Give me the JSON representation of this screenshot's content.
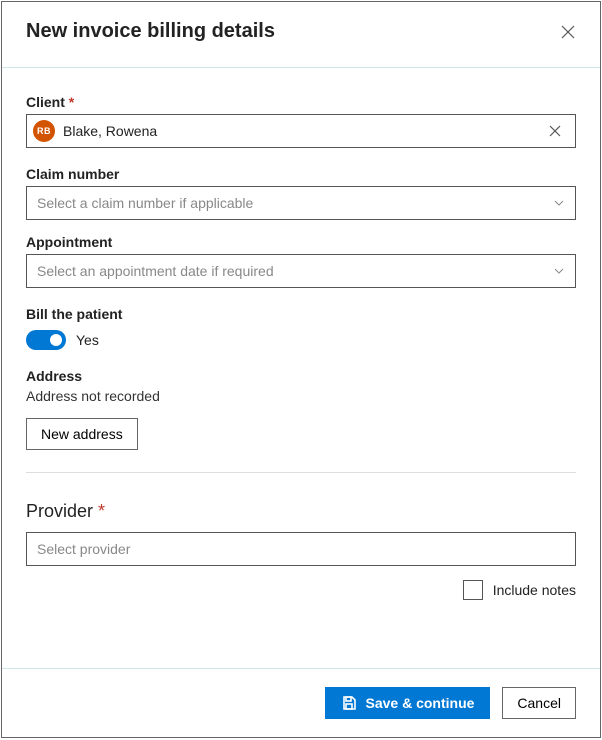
{
  "header": {
    "title": "New invoice billing details"
  },
  "client": {
    "label": "Client",
    "avatar_initials": "RB",
    "value": "Blake, Rowena"
  },
  "claim": {
    "label": "Claim number",
    "placeholder": "Select a claim number if applicable"
  },
  "appointment": {
    "label": "Appointment",
    "placeholder": "Select an appointment date if required"
  },
  "bill_patient": {
    "label": "Bill the patient",
    "value_text": "Yes"
  },
  "address": {
    "label": "Address",
    "value": "Address not recorded",
    "new_button": "New address"
  },
  "provider": {
    "label": "Provider",
    "placeholder": "Select provider"
  },
  "include_notes": {
    "label": "Include notes"
  },
  "footer": {
    "save": "Save & continue",
    "cancel": "Cancel"
  }
}
